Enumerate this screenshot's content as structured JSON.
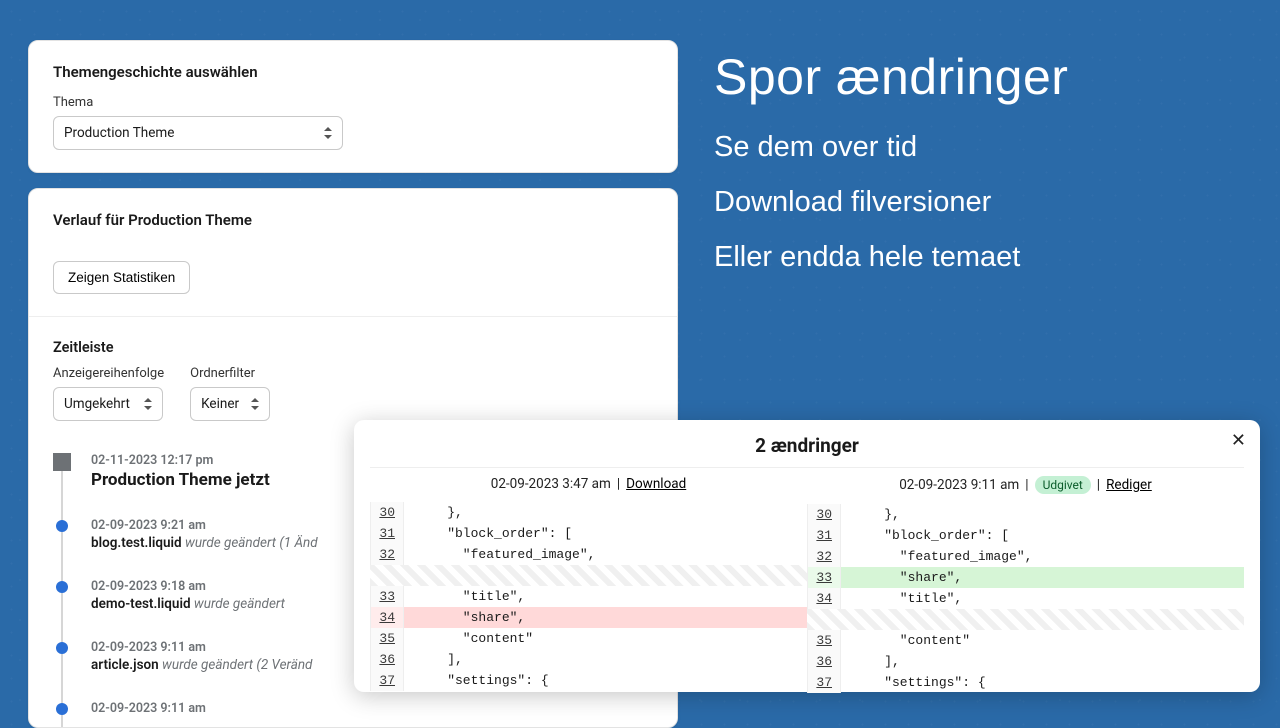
{
  "pick": {
    "title": "Themengeschichte auswählen",
    "theme_label": "Thema",
    "theme_value": "Production Theme"
  },
  "history": {
    "title": "Verlauf für Production Theme",
    "show_stats": "Zeigen Statistiken",
    "timeline_label": "Zeitleiste",
    "order_label": "Anzeigereihenfolge",
    "order_value": "Umgekehrt",
    "filter_label": "Ordnerfilter",
    "filter_value": "Keiner"
  },
  "timeline": [
    {
      "ts": "02-11-2023 12:17 pm",
      "headline": "Production Theme jetzt"
    },
    {
      "ts": "02-09-2023 9:21 am",
      "file": "blog.test.liquid",
      "rest": " wurde geändert (1 Änd"
    },
    {
      "ts": "02-09-2023 9:18 am",
      "file": "demo-test.liquid",
      "rest": " wurde geändert"
    },
    {
      "ts": "02-09-2023 9:11 am",
      "file": "article.json",
      "rest": " wurde geändert (2 Veränd"
    },
    {
      "ts": "02-09-2023 9:11 am",
      "file": "",
      "rest": ""
    }
  ],
  "promo": {
    "title": "Spor ændringer",
    "l1": "Se dem over tid",
    "l2": "Download filversioner",
    "l3": "Eller endda hele temaet"
  },
  "modal": {
    "title": "2 ændringer",
    "left_ts": "02-09-2023 3:47 am",
    "download": "Download",
    "right_ts": "02-09-2023 9:11 am",
    "published": "Udgivet",
    "edit": "Rediger",
    "left_lines": [
      {
        "n": "30",
        "t": "    },"
      },
      {
        "n": "31",
        "t": "    \"block_order\": ["
      },
      {
        "n": "32",
        "t": "      \"featured_image\","
      },
      {
        "placeholder": true
      },
      {
        "n": "33",
        "t": "      \"title\","
      },
      {
        "n": "34",
        "t": "      \"share\",",
        "cls": "row-del"
      },
      {
        "n": "35",
        "t": "      \"content\""
      },
      {
        "n": "36",
        "t": "    ],"
      },
      {
        "n": "37",
        "t": "    \"settings\": {"
      }
    ],
    "right_lines": [
      {
        "n": "30",
        "t": "    },"
      },
      {
        "n": "31",
        "t": "    \"block_order\": ["
      },
      {
        "n": "32",
        "t": "      \"featured_image\","
      },
      {
        "n": "33",
        "t": "      \"share\",",
        "cls": "row-add"
      },
      {
        "n": "34",
        "t": "      \"title\","
      },
      {
        "placeholder": true
      },
      {
        "n": "35",
        "t": "      \"content\""
      },
      {
        "n": "36",
        "t": "    ],"
      },
      {
        "n": "37",
        "t": "    \"settings\": {"
      }
    ]
  }
}
